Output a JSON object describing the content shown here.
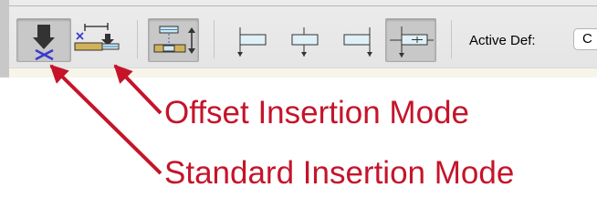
{
  "toolbar": {
    "buttons": [
      {
        "id": "standard-insertion-mode",
        "pressed": true
      },
      {
        "id": "offset-insertion-mode",
        "pressed": false
      },
      {
        "id": "insertion-option",
        "pressed": true
      },
      {
        "id": "align-left-bottom",
        "pressed": false
      },
      {
        "id": "align-center-bottom",
        "pressed": false
      },
      {
        "id": "align-right-bottom",
        "pressed": false
      },
      {
        "id": "align-center",
        "pressed": true
      }
    ],
    "active_def_label": "Active Def:",
    "active_def_value": "C"
  },
  "annotations": {
    "offset": "Offset Insertion Mode",
    "standard": "Standard Insertion Mode",
    "color": "#c5142a"
  }
}
